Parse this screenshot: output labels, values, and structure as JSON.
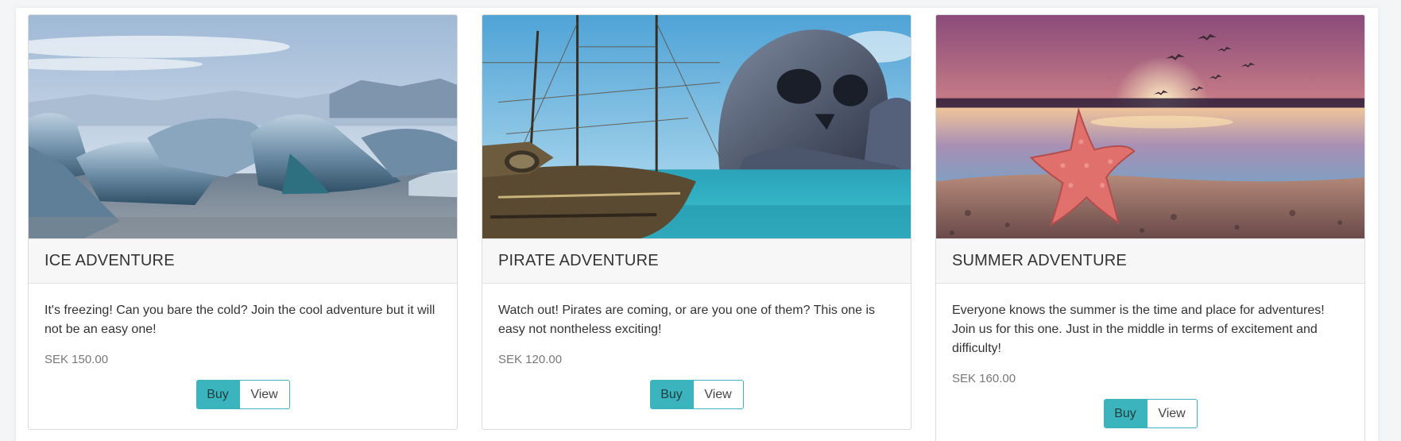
{
  "products": [
    {
      "title": "ICE ADVENTURE",
      "description": "It's freezing! Can you bare the cold? Join the cool adventure but it will not be an easy one!",
      "price": "SEK 150.00",
      "buy_label": "Buy",
      "view_label": "View",
      "image_alt": "icebergs"
    },
    {
      "title": "PIRATE ADVENTURE",
      "description": "Watch out! Pirates are coming, or are you one of them? This one is easy not nontheless exciting!",
      "price": "SEK 120.00",
      "buy_label": "Buy",
      "view_label": "View",
      "image_alt": "pirate ship and skull rock"
    },
    {
      "title": "SUMMER ADVENTURE",
      "description": "Everyone knows the summer is the time and place for adventures! Join us for this one. Just in the middle in terms of excitement and difficulty!",
      "price": "SEK 160.00",
      "buy_label": "Buy",
      "view_label": "View",
      "image_alt": "starfish on beach at sunset"
    }
  ],
  "colors": {
    "accent": "#3cb4bd",
    "header_bg": "#f7f7f7",
    "border": "#dcdcdc"
  }
}
